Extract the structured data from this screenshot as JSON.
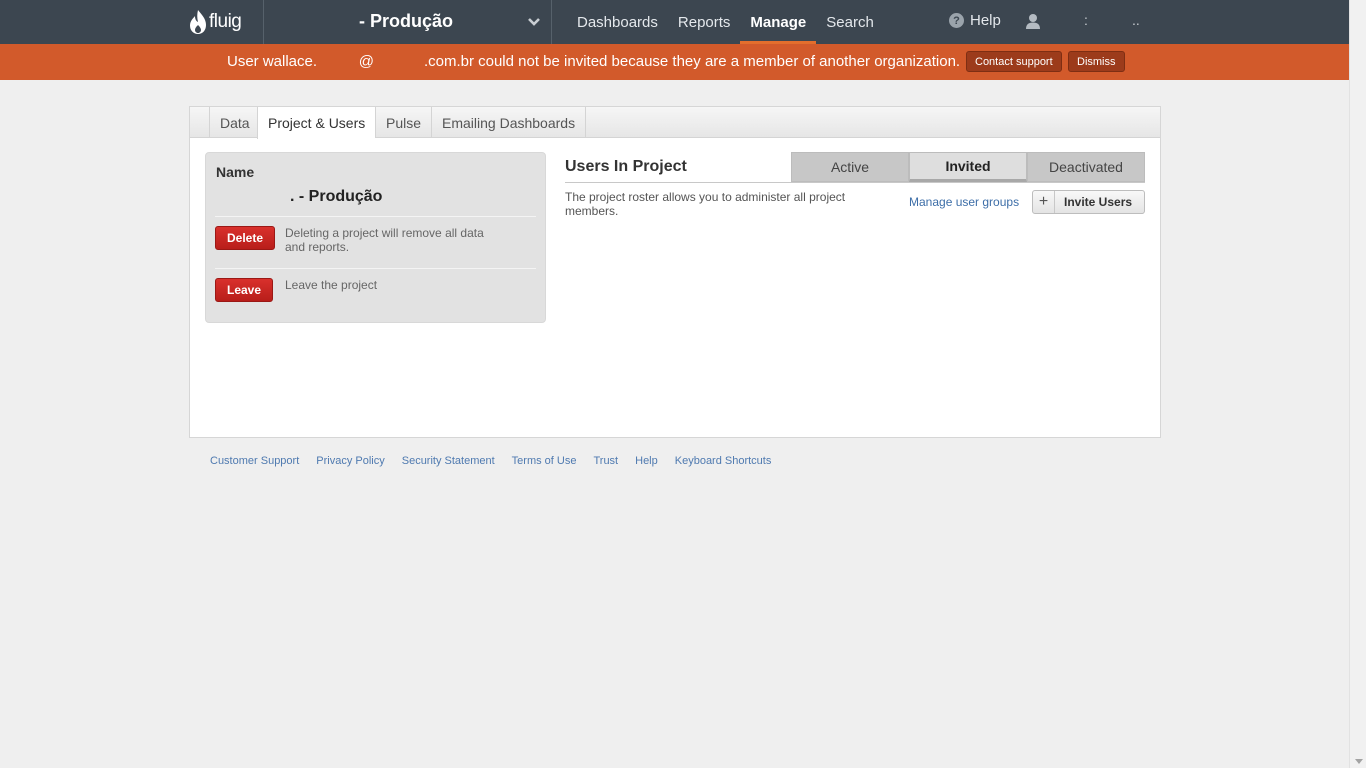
{
  "app": {
    "logo_text": "fluig",
    "project_title": "- Produção"
  },
  "nav": {
    "items": [
      {
        "label": "Dashboards",
        "active": false
      },
      {
        "label": "Reports",
        "active": false
      },
      {
        "label": "Manage",
        "active": true
      },
      {
        "label": "Search",
        "active": false
      }
    ],
    "help_label": "Help",
    "user_dots_1": ":",
    "user_dots_2": ".."
  },
  "alert": {
    "message": "User wallace.          @            .com.br could not be invited because they are a member of another organization.",
    "contact_label": "Contact support",
    "dismiss_label": "Dismiss",
    "color": "#d25a2b"
  },
  "tabs": [
    {
      "label": "Data",
      "active": false
    },
    {
      "label": "Project & Users",
      "active": true
    },
    {
      "label": "Pulse",
      "active": false
    },
    {
      "label": "Emailing Dashboards",
      "active": false
    }
  ],
  "project_card": {
    "name_label": "Name",
    "name_value": ". - Produção",
    "delete_label": "Delete",
    "delete_desc": "Deleting a project will remove all data and reports.",
    "leave_label": "Leave",
    "leave_desc": "Leave the project"
  },
  "users": {
    "title": "Users In Project",
    "status_tabs": [
      {
        "label": "Active",
        "active": false
      },
      {
        "label": "Invited",
        "active": true
      },
      {
        "label": "Deactivated",
        "active": false
      }
    ],
    "roster_desc": "The project roster allows you to administer all project members.",
    "manage_groups_label": "Manage user groups",
    "invite_label": "Invite Users"
  },
  "footer": {
    "links": [
      "Customer Support",
      "Privacy Policy",
      "Security Statement",
      "Terms of Use",
      "Trust",
      "Help",
      "Keyboard Shortcuts"
    ]
  }
}
